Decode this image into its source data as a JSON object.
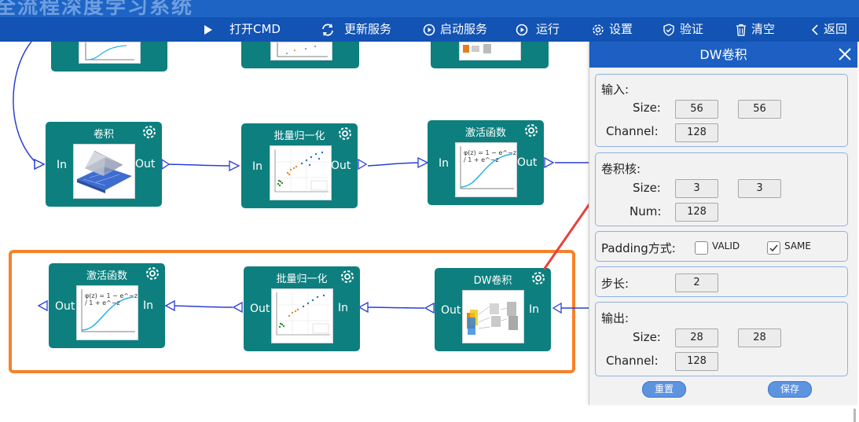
{
  "header": {
    "ghost_title": "全流程深度学习系统"
  },
  "toolbar": {
    "open_cmd": "打开CMD",
    "update_service": "更新服务",
    "start_service": "启动服务",
    "run": "运行",
    "settings": "设置",
    "verify": "验证",
    "clear": "清空",
    "back": "返回"
  },
  "colors": {
    "toolbar_bg": "#1253b3",
    "node_bg": "#0e7f7f",
    "highlight": "#f5822a",
    "arrow": "#e8413c",
    "link": "#2a3fd6"
  },
  "nodes": [
    {
      "title": "卷积",
      "in": "In",
      "out": "Out",
      "icon": "conv-3d-plot"
    },
    {
      "title": "批量归一化",
      "in": "In",
      "out": "Out",
      "icon": "scatter-plot"
    },
    {
      "title": "激活函数",
      "in": "In",
      "out": "Out",
      "icon": "sigmoid-plot",
      "formula": "φ(z) = 1 − e^−z / 1 + e^−z"
    },
    {
      "title": "激活函数",
      "in": "In",
      "out": "Out",
      "icon": "sigmoid-plot",
      "formula": "φ(z) = 1 − e^−z / 1 + e^−z"
    },
    {
      "title": "批量归一化",
      "in": "In",
      "out": "Out",
      "icon": "scatter-plot"
    },
    {
      "title": "DW卷积",
      "in": "In",
      "out": "Out",
      "icon": "depthwise-conv-diagram"
    }
  ],
  "panel": {
    "title": "DW卷积",
    "input": {
      "heading": "输入:",
      "size_label": "Size:",
      "size_w": "56",
      "size_h": "56",
      "channel_label": "Channel:",
      "channel": "128"
    },
    "kernel": {
      "heading": "卷积核:",
      "size_label": "Size:",
      "size_w": "3",
      "size_h": "3",
      "num_label": "Num:",
      "num": "128"
    },
    "padding": {
      "label": "Padding方式:",
      "opt_valid": "VALID",
      "opt_same": "SAME",
      "valid_checked": false,
      "same_checked": true
    },
    "stride": {
      "label": "步长:",
      "value": "2"
    },
    "output": {
      "heading": "输出:",
      "size_label": "Size:",
      "size_w": "28",
      "size_h": "28",
      "channel_label": "Channel:",
      "channel": "128"
    },
    "reset": "重置",
    "save": "保存"
  }
}
